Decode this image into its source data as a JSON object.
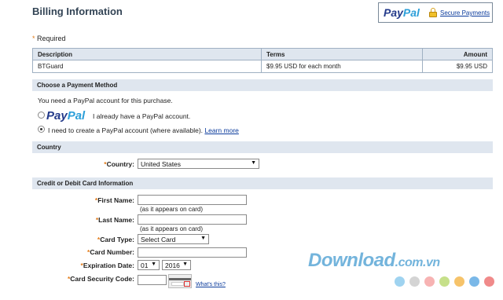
{
  "header": {
    "title": "Billing Information",
    "paypal_pay": "Pay",
    "paypal_pal": "Pal",
    "secure_link": "Secure Payments"
  },
  "required_label": "Required",
  "items_table": {
    "columns": [
      "Description",
      "Terms",
      "Amount"
    ],
    "rows": [
      {
        "description": "BTGuard",
        "terms": "$9.95 USD for each month",
        "amount": "$9.95 USD"
      }
    ]
  },
  "payment_method": {
    "section_title": "Choose a Payment Method",
    "intro": "You need a PayPal account for this purchase.",
    "paypal_pay": "Pay",
    "paypal_pal": "Pal",
    "option_have": "I already have a PayPal account.",
    "option_create": "I need to create a PayPal account (where available).",
    "learn_more": "Learn more",
    "selected": "create"
  },
  "country": {
    "section_title": "Country",
    "label": "Country:",
    "value": "United States"
  },
  "card": {
    "section_title": "Credit or Debit Card Information",
    "first_name_label": "First Name:",
    "first_name_value": "",
    "first_name_hint": "(as it appears on card)",
    "last_name_label": "Last Name:",
    "last_name_value": "",
    "last_name_hint": "(as it appears on card)",
    "card_type_label": "Card Type:",
    "card_type_value": "Select Card",
    "card_number_label": "Card Number:",
    "card_number_value": "",
    "expiration_label": "Expiration Date:",
    "exp_month": "01",
    "exp_year": "2016",
    "security_label": "Card Security Code:",
    "security_value": "",
    "whats_this": "What's this?"
  },
  "watermark": {
    "text": "Download",
    "suffix": ".com.vn",
    "dot_colors": [
      "#9fd3f0",
      "#d4d4d4",
      "#f7b3b3",
      "#c6e08a",
      "#f6c36a",
      "#7ab8e8",
      "#f08a8a"
    ]
  },
  "colors": {
    "section_bg": "#dfe6ef",
    "required_star": "#e27b1a",
    "link": "#0b3b9c",
    "title": "#334455"
  }
}
